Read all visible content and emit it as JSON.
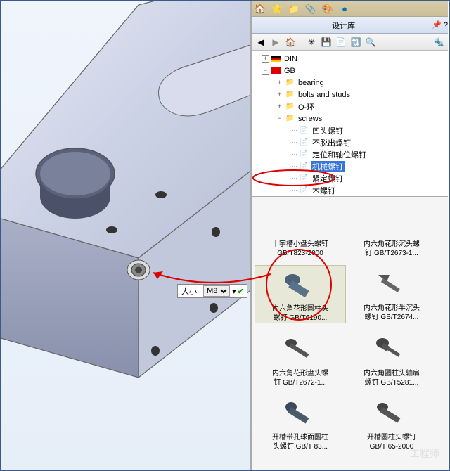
{
  "panel": {
    "title": "设计库"
  },
  "size": {
    "label": "大小:",
    "value": "M8"
  },
  "tree": {
    "din": "DIN",
    "gb": "GB",
    "n1": "bearing",
    "n2": "bolts and studs",
    "n3": "O-环",
    "n4": "screws",
    "s1": "凹头螺钉",
    "s2": "不脱出螺钉",
    "s3": "定位和轴位螺钉",
    "s4": "机械螺钉",
    "s5": "紧定螺钉",
    "s6": "木螺钉"
  },
  "items": {
    "i1a": "十字槽小盘头螺钉",
    "i1b": "GB/T823-2000",
    "i2a": "内六角花形沉头螺",
    "i2b": "钉 GB/T2673-1...",
    "i3a": "内六角花形圆柱头",
    "i3b": "螺钉 GB/T6190...",
    "i4a": "内六角花形半沉头",
    "i4b": "螺钉 GB/T2674...",
    "i5a": "内六角花形盘头螺",
    "i5b": "钉 GB/T2672-1...",
    "i6a": "内六角圆柱头轴肩",
    "i6b": "螺钉 GB/T5281...",
    "i7a": "开槽带孔球面圆柱",
    "i7b": "头螺钉 GB/T 83...",
    "i8a": "开槽圆柱头螺钉",
    "i8b": "GB/T 65-2000"
  }
}
